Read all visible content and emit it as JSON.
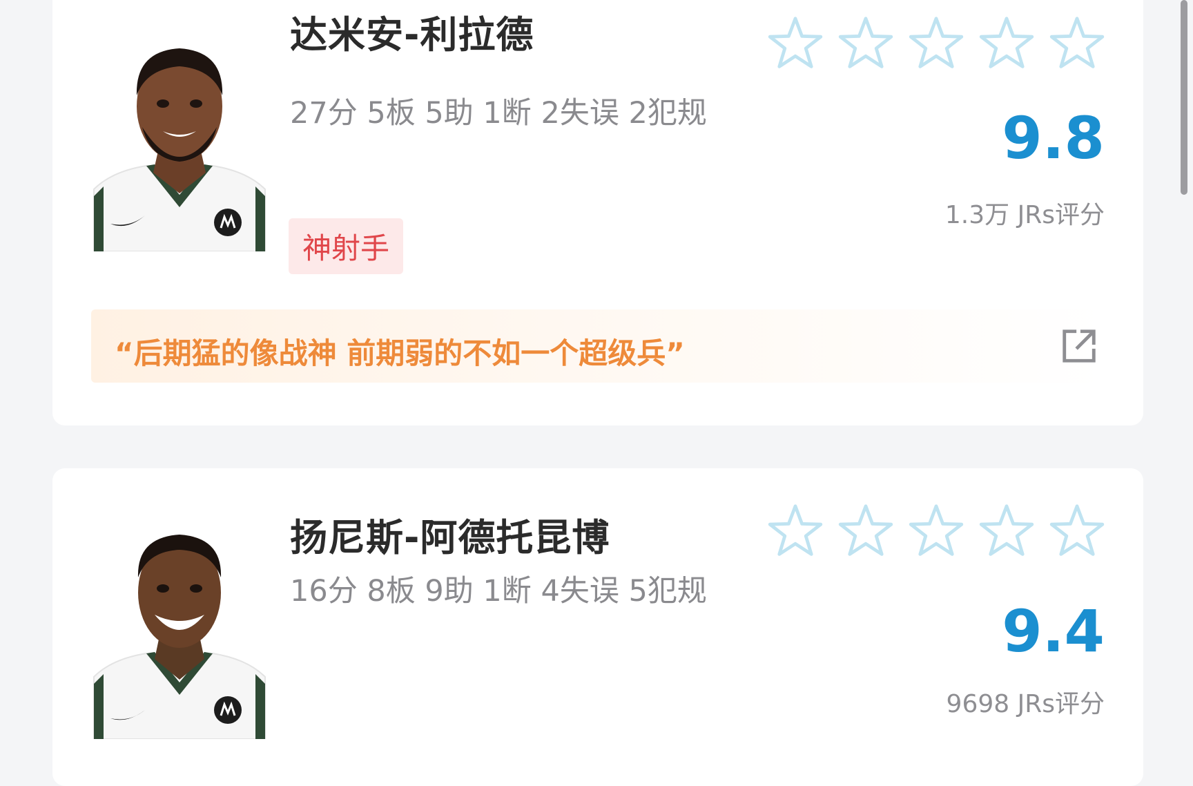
{
  "players": [
    {
      "name": "达米安-利拉德",
      "stats": "27分 5板 5助 1断 2失误 2犯规",
      "tag": "神射手",
      "stars": 5,
      "score": "9.8",
      "rating_count": "1.3万 JRs评分",
      "comment": "“后期猛的像战神 前期弱的不如一个超级兵”"
    },
    {
      "name": "扬尼斯-阿德托昆博",
      "stats": "16分 8板 9助 1断 4失误 5犯规",
      "stars": 5,
      "score": "9.4",
      "rating_count": "9698 JRs评分"
    }
  ],
  "colors": {
    "score": "#1b8fd0",
    "star_outline": "#bfe3f1",
    "tag_text": "#e0464a",
    "tag_bg": "#fde9e9",
    "comment_text": "#ee8a3a"
  },
  "icons": {
    "star": "star-outline-icon",
    "share": "share-external-icon"
  }
}
